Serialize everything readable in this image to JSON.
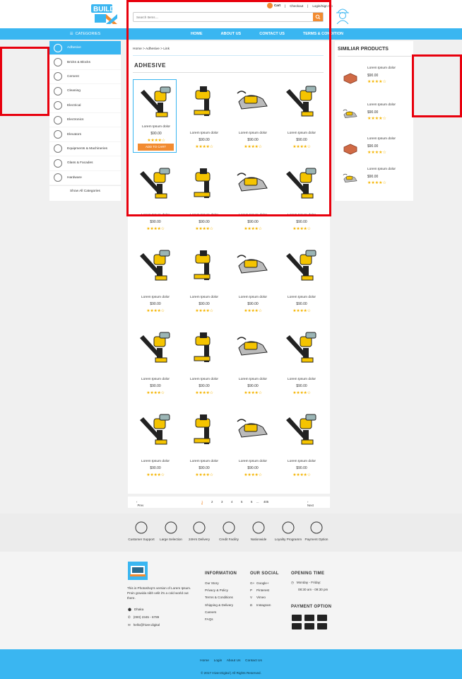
{
  "header": {
    "cart": "Cart",
    "checkout": "Checkout",
    "login": "Login/Sign Up",
    "search_placeholder": "Search Items...."
  },
  "nav": {
    "categories_label": "CATEGORIES",
    "items": [
      "HOME",
      "ABOUT US",
      "CONTACT US",
      "TERMS & CONDITION"
    ]
  },
  "sidebar": {
    "items": [
      "Adhesive",
      "Bricks & Blocks",
      "Cement",
      "Cleaning",
      "Electrical",
      "Electronics",
      "Elevators",
      "Equipments & Machineries",
      "Glass & Facades",
      "Hardware"
    ],
    "show_all": "Show All Categories"
  },
  "main": {
    "breadcrumb": "Home > Adhesive > Link",
    "title": "ADHESIVE",
    "product_name": "Lorem Ipsum dolor",
    "product_price": "$90.00",
    "stars": "★★★★☆",
    "add_to_cart": "ADD TO CART"
  },
  "pagination": {
    "prev": "Prev",
    "next": "Next",
    "pages": [
      "1",
      "2",
      "3",
      "4",
      "5",
      "6",
      "...",
      "405"
    ]
  },
  "similar": {
    "title": "SIMILIAR PRODUCTS",
    "name": "Lorem Ipsum dolor",
    "price": "$90.00",
    "stars": "★★★★☆"
  },
  "features": [
    "Customer Support",
    "Large Selection",
    "24Hrs Delivery",
    "Credit Facility",
    "Nationwide",
    "Loyality Programm",
    "Payment Option"
  ],
  "footer": {
    "about": "This is Photoshop's version of Lorem Ipsum. Proin gravida nibh velit it's a cold world out there.",
    "city": "Dhaka",
    "phone": "(000) 2345 - 6789",
    "email": "hello@hiver.digital",
    "info_title": "INFORMATION",
    "info_links": [
      "Our Story",
      "Privacy & Policy",
      "Terms & Conditions",
      "Shipping & Delivery",
      "Careers",
      "FAQs"
    ],
    "social_title": "OUR SOCIAL",
    "social_links": [
      "Google+",
      "Pinterest",
      "Vimeo",
      "Instagram"
    ],
    "hours_title": "OPENING TIME",
    "hours_days": "Monday - Friday:",
    "hours_time": "08:30 am - 09:30 pm",
    "payment_title": "PAYMENT OPTION",
    "bottom_links": [
      "Home",
      "Login",
      "About Us",
      "Contact Us"
    ],
    "copyright": "© 2017 Hiver.Digital  |  All Rights Reserved."
  },
  "colors": {
    "accent": "#3ab6f1",
    "orange": "#f28b30",
    "star": "#f5b400",
    "highlight": "#e8000d"
  }
}
